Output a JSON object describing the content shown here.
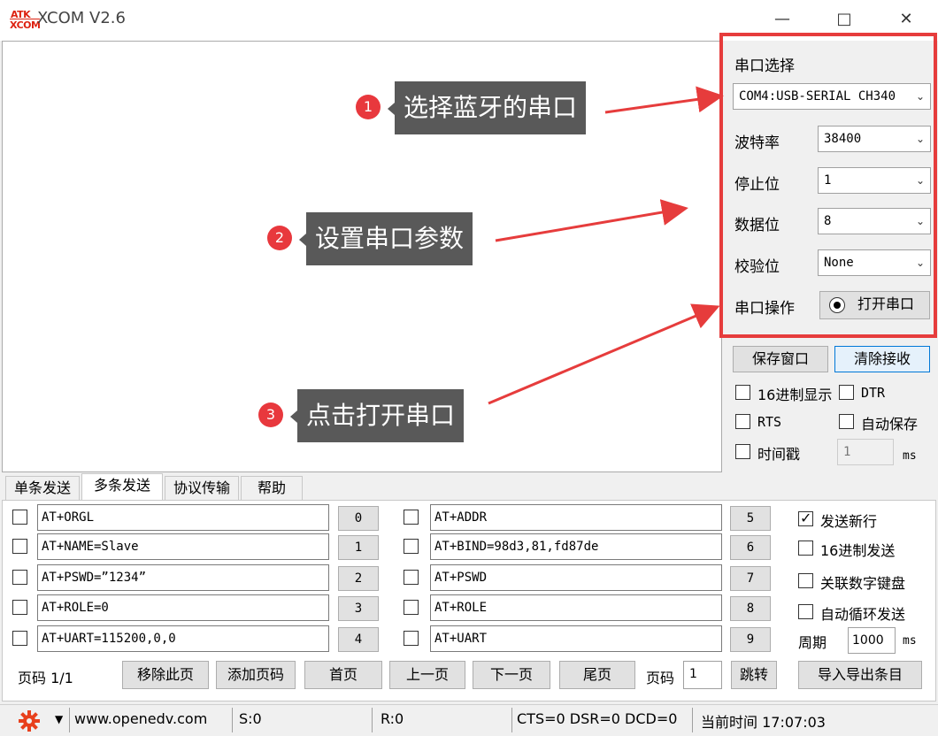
{
  "window": {
    "title": "XCOM V2.6",
    "logo_top": "ATK",
    "logo_bottom": "XCOM"
  },
  "port_panel": {
    "port_select_label": "串口选择",
    "port_value": "COM4:USB-SERIAL CH340",
    "baud_label": "波特率",
    "baud_value": "38400",
    "stopbits_label": "停止位",
    "stopbits_value": "1",
    "databits_label": "数据位",
    "databits_value": "8",
    "parity_label": "校验位",
    "parity_value": "None",
    "operation_label": "串口操作",
    "open_port_button": "打开串口"
  },
  "receive_options": {
    "save_window_button": "保存窗口",
    "clear_receive_button": "清除接收",
    "hex_display": "16进制显示",
    "dtr": "DTR",
    "rts": "RTS",
    "auto_save": "自动保存",
    "timestamp": "时间戳",
    "timestamp_value": "1",
    "ms": "ms"
  },
  "tabs": [
    "单条发送",
    "多条发送",
    "协议传输",
    "帮助"
  ],
  "commands_left": [
    {
      "text": "AT+ORGL",
      "num": "0"
    },
    {
      "text": "AT+NAME=Slave",
      "num": "1"
    },
    {
      "text": "AT+PSWD=”1234”",
      "num": "2"
    },
    {
      "text": "AT+ROLE=0",
      "num": "3"
    },
    {
      "text": "AT+UART=115200,0,0",
      "num": "4"
    }
  ],
  "commands_right": [
    {
      "text": "AT+ADDR",
      "num": "5"
    },
    {
      "text": "AT+BIND=98d3,81,fd87de",
      "num": "6"
    },
    {
      "text": "AT+PSWD",
      "num": "7"
    },
    {
      "text": "AT+ROLE",
      "num": "8"
    },
    {
      "text": "AT+UART",
      "num": "9"
    }
  ],
  "send_options": {
    "send_newline": "发送新行",
    "send_newline_checked": true,
    "hex_send": "16进制发送",
    "link_numpad": "关联数字键盘",
    "auto_loop": "自动循环发送",
    "period_label": "周期",
    "period_value": "1000",
    "ms": "ms"
  },
  "paging": {
    "page_label": "页码 1/1",
    "remove_page": "移除此页",
    "add_page": "添加页码",
    "first": "首页",
    "prev": "上一页",
    "next": "下一页",
    "last": "尾页",
    "page_input_label": "页码",
    "page_input_value": "1",
    "jump": "跳转",
    "import_export": "导入导出条目"
  },
  "status": {
    "url": "www.openedv.com",
    "sent": "S:0",
    "received": "R:0",
    "lines": "CTS=0 DSR=0 DCD=0",
    "time": "当前时间 17:07:03"
  },
  "annotations": [
    {
      "num": "1",
      "text": "选择蓝牙的串口"
    },
    {
      "num": "2",
      "text": "设置串口参数"
    },
    {
      "num": "3",
      "text": "点击打开串口"
    }
  ],
  "colors": {
    "annotation_red": "#e63c3c",
    "callout_bg": "#595959",
    "gear": "#e8401c"
  }
}
